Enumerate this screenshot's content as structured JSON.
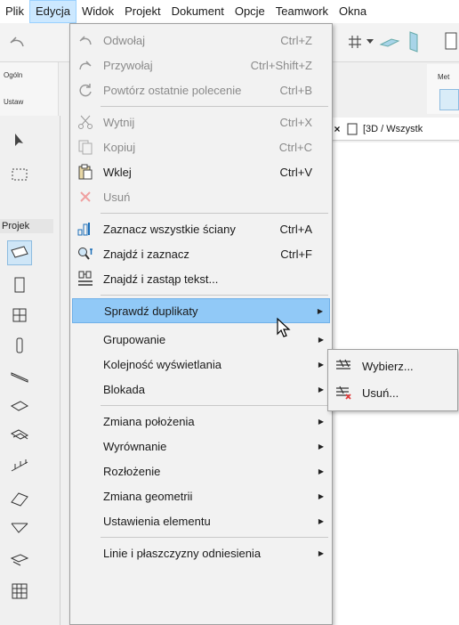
{
  "menubar": {
    "items": [
      {
        "label": "Plik"
      },
      {
        "label": "Edycja"
      },
      {
        "label": "Widok"
      },
      {
        "label": "Projekt"
      },
      {
        "label": "Dokument"
      },
      {
        "label": "Opcje"
      },
      {
        "label": "Teamwork"
      },
      {
        "label": "Okna"
      }
    ]
  },
  "background": {
    "panel_general": "Ogóln",
    "panel_settings": "Ustaw",
    "panel_method": "Met",
    "toolbox_title": "Projek",
    "view_tab_close": "×",
    "view_tab_title": "[3D / Wszystk"
  },
  "menu": {
    "items": [
      {
        "label": "Odwołaj",
        "shortcut": "Ctrl+Z",
        "enabled": false
      },
      {
        "label": "Przywołaj",
        "shortcut": "Ctrl+Shift+Z",
        "enabled": false
      },
      {
        "label": "Powtórz ostatnie polecenie",
        "shortcut": "Ctrl+B",
        "enabled": false
      },
      {
        "label": "Wytnij",
        "shortcut": "Ctrl+X",
        "enabled": false
      },
      {
        "label": "Kopiuj",
        "shortcut": "Ctrl+C",
        "enabled": false
      },
      {
        "label": "Wklej",
        "shortcut": "Ctrl+V",
        "enabled": true
      },
      {
        "label": "Usuń",
        "shortcut": "",
        "enabled": false
      },
      {
        "label": "Zaznacz wszystkie ściany",
        "shortcut": "Ctrl+A",
        "enabled": true
      },
      {
        "label": "Znajdź i zaznacz",
        "shortcut": "Ctrl+F",
        "enabled": true
      },
      {
        "label": "Znajdź i zastąp tekst...",
        "shortcut": "",
        "enabled": true
      },
      {
        "label": "Sprawdź duplikaty",
        "submenu": true,
        "highlighted": true
      },
      {
        "label": "Grupowanie",
        "submenu": true
      },
      {
        "label": "Kolejność wyświetlania",
        "submenu": true
      },
      {
        "label": "Blokada",
        "submenu": true
      },
      {
        "label": "Zmiana położenia",
        "submenu": true
      },
      {
        "label": "Wyrównanie",
        "submenu": true
      },
      {
        "label": "Rozłożenie",
        "submenu": true
      },
      {
        "label": "Zmiana geometrii",
        "submenu": true
      },
      {
        "label": "Ustawienia elementu",
        "submenu": true
      },
      {
        "label": "Linie i płaszczyzny odniesienia",
        "submenu": true
      }
    ]
  },
  "submenu": {
    "items": [
      {
        "label": "Wybierz..."
      },
      {
        "label": "Usuń..."
      }
    ]
  },
  "colors": {
    "highlight": "#91c9f7",
    "menubar_open": "#cce8ff",
    "disabled_text": "#8a8a8a",
    "delete_red": "#e23b3b"
  }
}
